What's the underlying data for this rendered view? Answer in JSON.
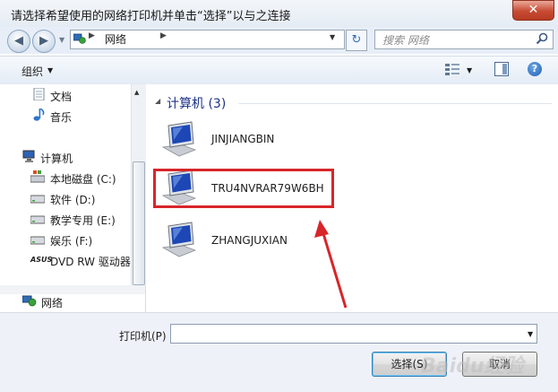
{
  "window": {
    "title": "请选择希望使用的网络打印机并单击“选择”以与之连接",
    "close_label": "✕"
  },
  "address_bar": {
    "path_label": "网络",
    "search_placeholder": "搜索 网络"
  },
  "toolbar": {
    "organize_label": "组织",
    "help_label": "?"
  },
  "nav": {
    "items": [
      {
        "label": "文档",
        "icon": "document-icon"
      },
      {
        "label": "音乐",
        "icon": "music-icon"
      },
      {
        "label": "计算机",
        "icon": "computer-icon"
      },
      {
        "label": "本地磁盘 (C:)",
        "icon": "windows-drive-icon"
      },
      {
        "label": "软件 (D:)",
        "icon": "drive-icon"
      },
      {
        "label": "教学专用 (E:)",
        "icon": "drive-icon"
      },
      {
        "label": "娱乐 (F:)",
        "icon": "drive-icon"
      },
      {
        "label": "DVD RW 驱动器",
        "icon": "dvd-drive-icon",
        "logo_text": "ASUS"
      },
      {
        "label": "网络",
        "icon": "network-icon"
      }
    ]
  },
  "main": {
    "group_header": "计算机 (3)",
    "computers": [
      {
        "name": "JINJIANGBIN"
      },
      {
        "name": "TRU4NVRAR79W6BH",
        "highlighted": true
      },
      {
        "name": "ZHANGJUXIAN"
      }
    ],
    "annotation_color": "#d7262a"
  },
  "bottom": {
    "printer_label": "打印机(P)",
    "printer_value": "",
    "select_button": "选择(S)",
    "cancel_button": "取消"
  },
  "watermark": "Baidu经验"
}
